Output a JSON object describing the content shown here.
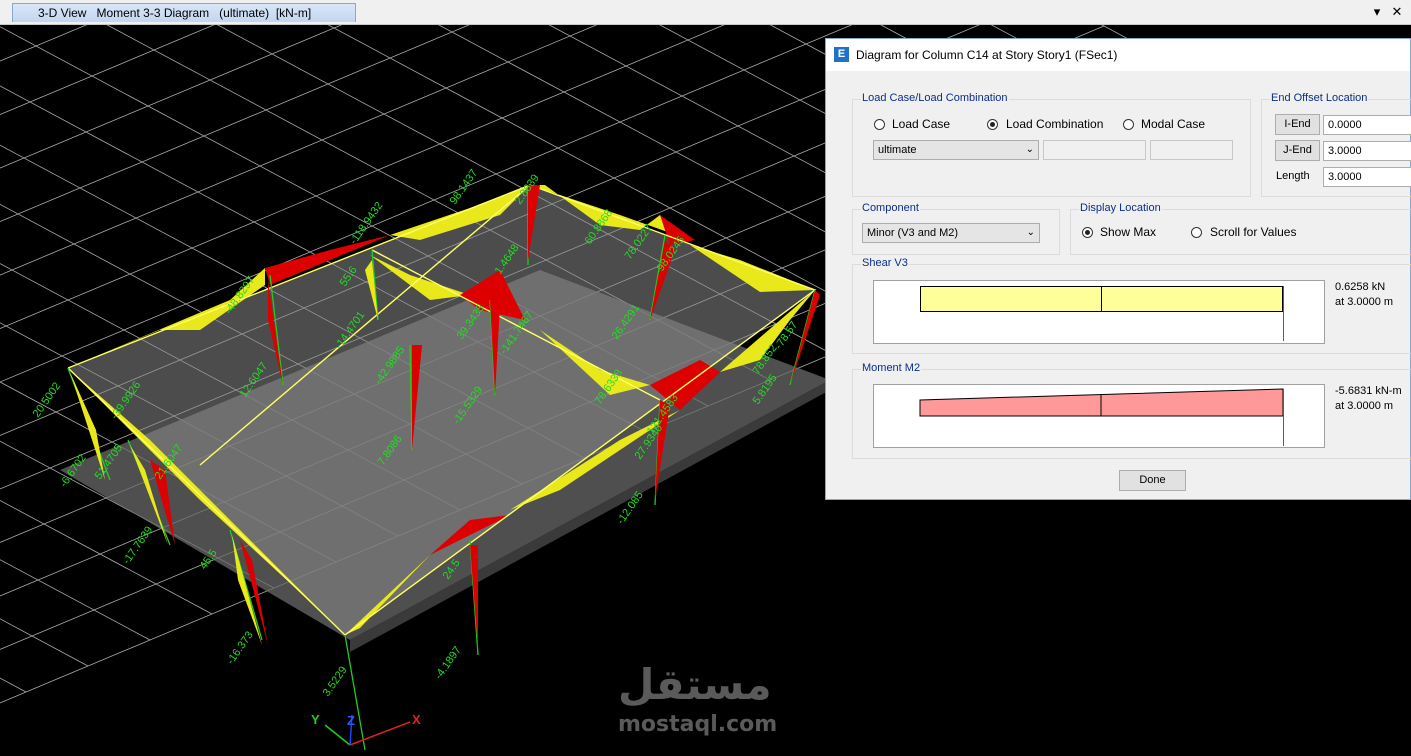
{
  "window": {
    "tab_label": "3-D View   Moment 3-3 Diagram   (ultimate)  [kN-m]",
    "dropdown_glyph": "▾",
    "close_glyph": "✕"
  },
  "viewport": {
    "member_labels": [
      "-118.9432",
      "98.1437",
      "2.8639",
      "60.8868",
      "78.0227",
      "-98.0245",
      "55.6",
      "-14.4701",
      "-48.8297",
      "12.6047",
      "-42.9885",
      "7.8086",
      "39.3435",
      "-141.7467",
      "-15.5329",
      "78.6338",
      "26.4291",
      "78.852",
      "5.8195",
      "-78.57",
      "20.5002",
      "-39.9926",
      "21.6047",
      "-6.6702",
      "51.4705",
      "-17.7639",
      "45.5",
      "-16.373",
      "27.9340",
      "-121.4583",
      "-12.085",
      "24.5",
      "-4.1897",
      "3.5229",
      "1.4648"
    ],
    "axes": {
      "x": "X",
      "y": "Y",
      "z": "Z"
    },
    "colors": {
      "positive": "#ffff00",
      "negative": "#ee0000",
      "beam": "#ffff88",
      "grid": "#bfbfbf",
      "label": "#22dd22"
    }
  },
  "watermark": {
    "arabic": "مستقل",
    "latin": "mostaql.com"
  },
  "dialog": {
    "title": "Diagram for Column C14 at Story Story1 (FSec1)",
    "icon_letter": "E",
    "load": {
      "group_title": "Load Case/Load Combination",
      "options": [
        "Load Case",
        "Load Combination",
        "Modal Case"
      ],
      "selected": "Load Combination",
      "combo_value": "ultimate"
    },
    "end_offset": {
      "group_title": "End Offset Location",
      "i_end_label": "I-End",
      "i_end_value": "0.0000",
      "j_end_label": "J-End",
      "j_end_value": "3.0000",
      "length_label": "Length",
      "length_value": "3.0000"
    },
    "component": {
      "group_title": "Component",
      "value": "Minor (V3 and M2)"
    },
    "display": {
      "group_title": "Display Location",
      "options": [
        "Show Max",
        "Scroll for Values"
      ],
      "selected": "Show Max"
    },
    "shear": {
      "group_title": "Shear V3",
      "value_text": "0.6258 kN",
      "location_text": "at 3.0000 m",
      "fill_color": "#ffff99"
    },
    "moment": {
      "group_title": "Moment M2",
      "value_text": "-5.6831 kN-m",
      "location_text": "at 3.0000 m",
      "fill_color": "#ff9999"
    },
    "done_label": "Done"
  }
}
